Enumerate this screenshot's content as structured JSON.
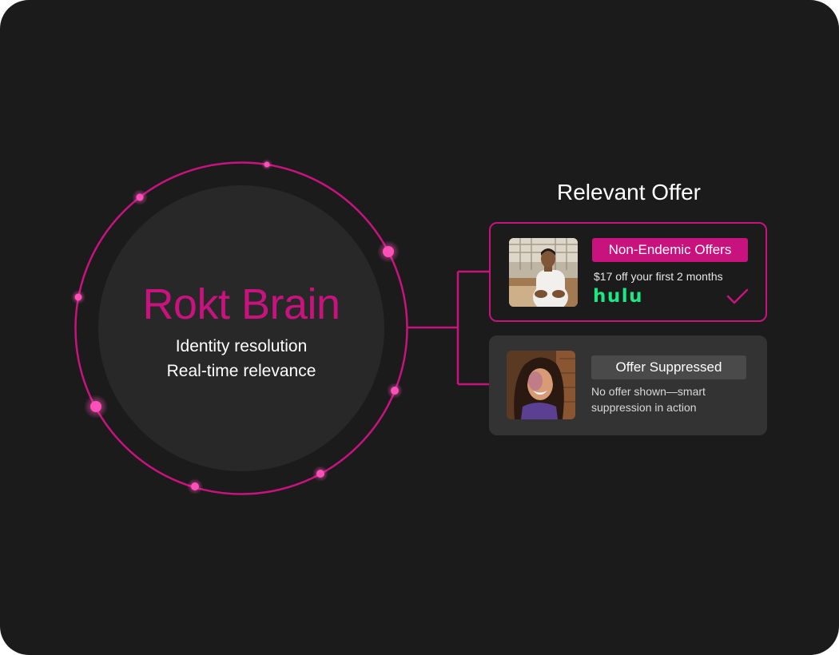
{
  "brain": {
    "title": "Rokt Brain",
    "lines": [
      "Identity resolution",
      "Real-time relevance"
    ]
  },
  "offers": {
    "heading": "Relevant Offer",
    "relevant": {
      "badge": "Non-Endemic Offers",
      "description": "$17 off your first 2 months",
      "brand": "hulu",
      "status_icon": "check-icon"
    },
    "suppressed": {
      "badge": "Offer Suppressed",
      "description": "No offer shown—smart suppression in action"
    }
  },
  "colors": {
    "background": "#1b1b1b",
    "accent": "#c8137f",
    "glow": "#ff4fb8",
    "inner_circle": "#282828",
    "suppressed_card": "#333333",
    "brand_green": "#1ce783"
  }
}
